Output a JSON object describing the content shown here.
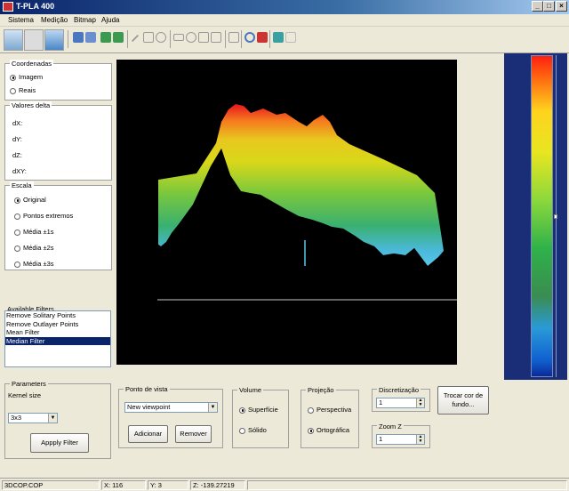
{
  "window": {
    "title": "T-PLA 400"
  },
  "menu": [
    "Sistema",
    "Medição",
    "Bitmap",
    "Ajuda"
  ],
  "coordenadas": {
    "title": "Coordenadas",
    "options": [
      "Imagem",
      "Reais"
    ],
    "selected": 0
  },
  "valores_delta": {
    "title": "Valores delta",
    "labels": [
      "dX:",
      "dY:",
      "dZ:",
      "dXY:"
    ]
  },
  "escala": {
    "title": "Escala",
    "options": [
      "Original",
      "Pontos extremos",
      "Média ±1s",
      "Média ±2s",
      "Média ±3s"
    ],
    "selected": 0
  },
  "filters": {
    "title": "Available Filters",
    "items": [
      "Remove Solitary Points",
      "Remove Outlayer Points",
      "Mean Filter",
      "Median Filter"
    ],
    "selected": 3
  },
  "parameters": {
    "title": "Parameters",
    "kernel_label": "Kernel size",
    "kernel_value": "3x3",
    "apply_label": "Appply Filter"
  },
  "ponto_de_vista": {
    "title": "Ponto de vista",
    "select_value": "New viewpoint",
    "add_label": "Adicionar",
    "remove_label": "Remover"
  },
  "volume": {
    "title": "Volume",
    "options": [
      "Superfície",
      "Sólido"
    ],
    "selected": 0
  },
  "projecao": {
    "title": "Projeção",
    "options": [
      "Perspectiva",
      "Ortográfica"
    ],
    "selected": 1
  },
  "discretizacao": {
    "title": "Discretização",
    "value": "1"
  },
  "zoom_z": {
    "title": "Zoom Z",
    "value": "1"
  },
  "trocar_cor": {
    "label": "Trocar cor de fundo..."
  },
  "status": {
    "file": "3DCOP.COP",
    "x": "X: 116",
    "y": "Y: 3",
    "z": "Z: -139.27219"
  },
  "colors": {
    "background": "#000000",
    "colorbar_frame": "#1a2e78"
  },
  "colorbar": {
    "slider_level": 0.5
  }
}
